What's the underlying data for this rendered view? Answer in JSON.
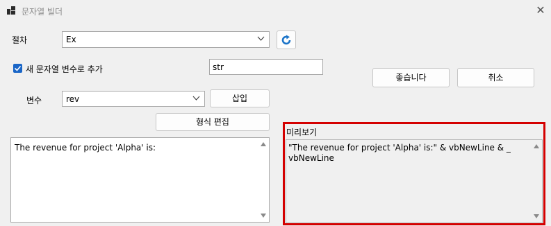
{
  "window": {
    "title": "문자열 빌더",
    "close_label": "✕"
  },
  "procedure": {
    "label": "절차",
    "value": "Ex"
  },
  "new_var": {
    "checked": true,
    "label": "새 문자열 변수로 추가",
    "name_value": "str"
  },
  "variable": {
    "label": "변수",
    "value": "rev"
  },
  "buttons": {
    "insert": "삽입",
    "format_edit": "형식 편집",
    "ok": "좋습니다",
    "cancel": "취소"
  },
  "input_text": "The revenue for project 'Alpha' is:",
  "preview": {
    "label": "미리보기",
    "line1": "\"The revenue for project 'Alpha' is:\" & vbNewLine & _",
    "line2": "vbNewLine"
  },
  "colors": {
    "highlight": "#d40000",
    "refresh_icon": "#1a73c8",
    "checkbox": "#1a66c7"
  },
  "icons": {
    "refresh": "refresh-icon",
    "dropdown": "chevron-down-icon",
    "checkbox": "checkmark-icon",
    "app": "app-icon",
    "close": "close-icon"
  }
}
